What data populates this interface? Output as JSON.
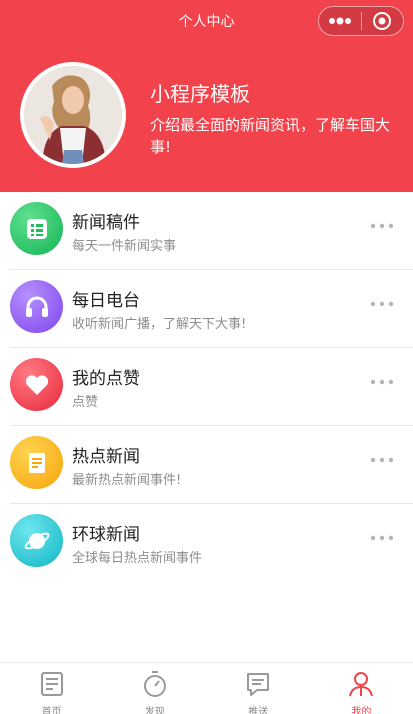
{
  "topbar": {
    "title": "个人中心"
  },
  "profile": {
    "name": "小程序模板",
    "description": "介绍最全面的新闻资讯，了解车国大事!"
  },
  "menu": [
    {
      "title": "新闻稿件",
      "subtitle": "每天一件新闻实事",
      "icon": "document-icon",
      "color": "#2fc76b"
    },
    {
      "title": "每日电台",
      "subtitle": "收听新闻广播，了解天下大事!",
      "icon": "headphones-icon",
      "color": "#8f5cf0"
    },
    {
      "title": "我的点赞",
      "subtitle": "点赞",
      "icon": "heart-icon",
      "color": "#f2424c"
    },
    {
      "title": "热点新闻",
      "subtitle": "最新热点新闻事件!",
      "icon": "news-icon",
      "color": "#fdb31a"
    },
    {
      "title": "环球新闻",
      "subtitle": "全球每日热点新闻事件",
      "icon": "planet-icon",
      "color": "#1ec8d6"
    }
  ],
  "tabs": [
    {
      "label": "首页",
      "icon": "home-icon"
    },
    {
      "label": "发现",
      "icon": "timer-icon"
    },
    {
      "label": "推送",
      "icon": "message-icon"
    },
    {
      "label": "我的",
      "icon": "user-icon",
      "active": true
    }
  ]
}
